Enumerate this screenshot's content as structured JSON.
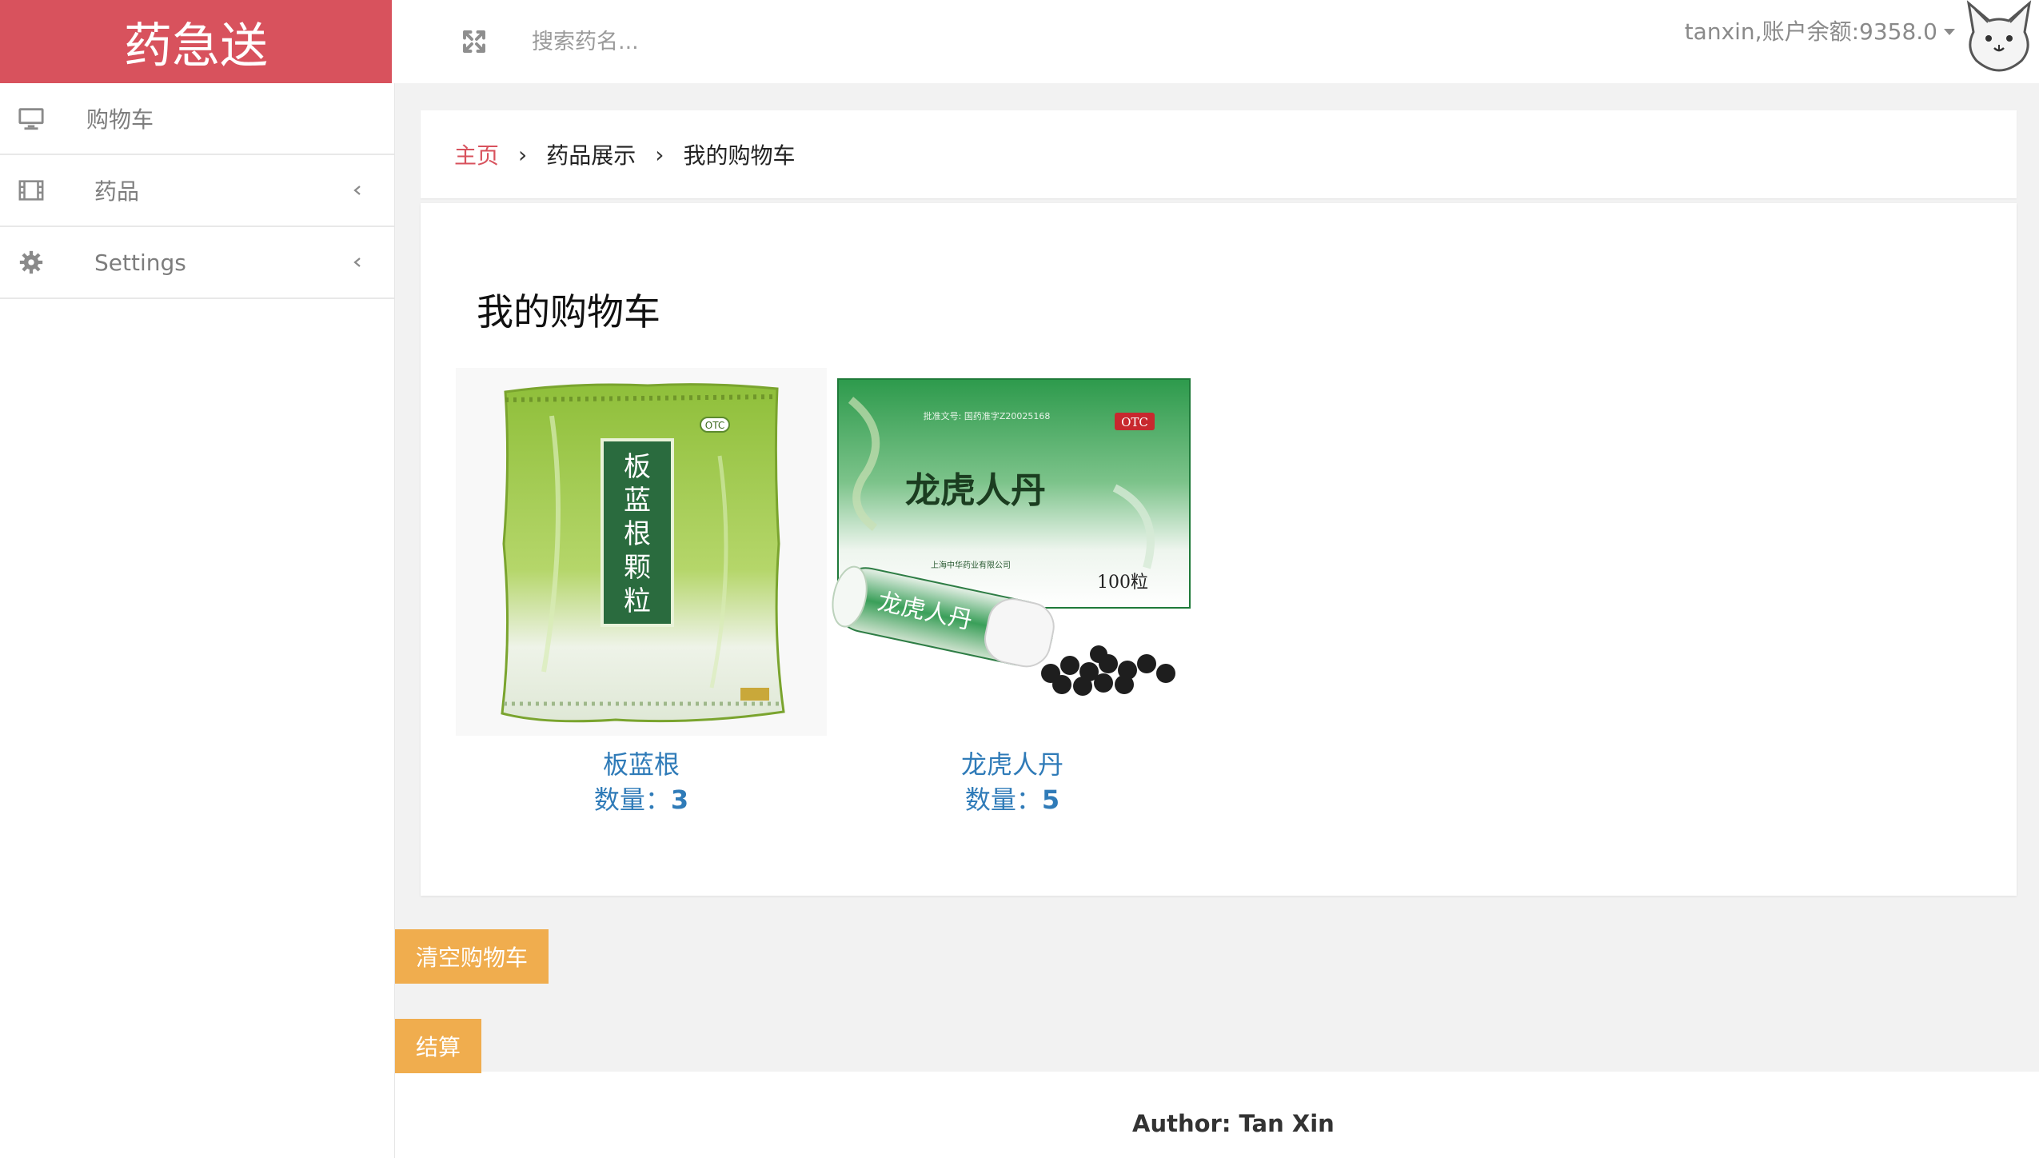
{
  "brand": {
    "title": "药急送",
    "color": "#d8525d"
  },
  "search": {
    "placeholder": "搜索药名..."
  },
  "user": {
    "label": "tanxin,账户余额:9358.0"
  },
  "sidebar": {
    "items": [
      {
        "label": "购物车",
        "icon": "monitor-icon"
      },
      {
        "label": "药品",
        "icon": "film-icon"
      },
      {
        "label": "Settings",
        "icon": "gear-icon"
      }
    ]
  },
  "breadcrumb": {
    "home": "主页",
    "level2": "药品展示",
    "current": "我的购物车"
  },
  "cart": {
    "title": "我的购物车",
    "items": [
      {
        "name": "板蓝根",
        "qty_label": "数量：",
        "qty": "3",
        "package_text": "板蓝根颗粒"
      },
      {
        "name": "龙虎人丹",
        "qty_label": "数量：",
        "qty": "5",
        "box_text": "龙虎人丹",
        "count_text": "100粒"
      }
    ]
  },
  "actions": {
    "clear_label": "清空购物车",
    "checkout_label": "结算",
    "button_color": "#f0ad4e"
  },
  "footer": {
    "text": "Author: Tan Xin"
  }
}
